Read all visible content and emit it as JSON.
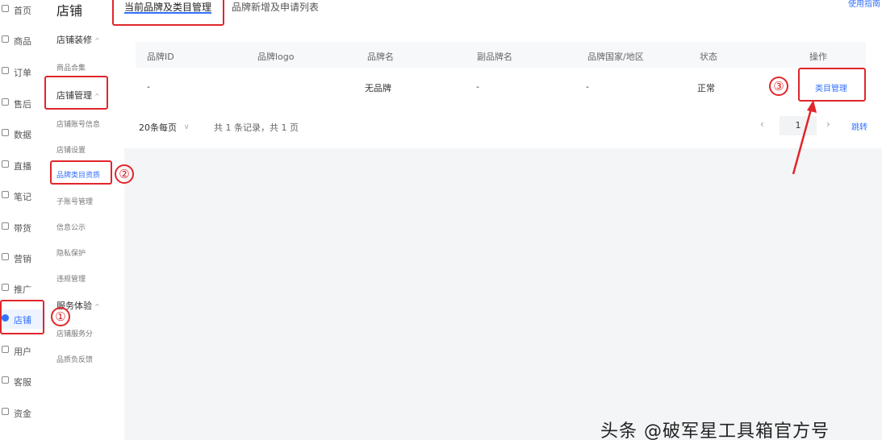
{
  "nav": {
    "items": [
      {
        "label": "首页",
        "icon": "home-icon"
      },
      {
        "label": "商品",
        "icon": "goods-icon"
      },
      {
        "label": "订单",
        "icon": "order-icon"
      },
      {
        "label": "售后",
        "icon": "after-sale-icon"
      },
      {
        "label": "数据",
        "icon": "data-icon"
      },
      {
        "label": "直播",
        "icon": "live-icon"
      },
      {
        "label": "笔记",
        "icon": "note-icon"
      },
      {
        "label": "带货",
        "icon": "promote-goods-icon"
      },
      {
        "label": "营销",
        "icon": "marketing-icon"
      },
      {
        "label": "推广",
        "icon": "ads-icon"
      },
      {
        "label": "店铺",
        "icon": "shop-icon"
      },
      {
        "label": "用户",
        "icon": "user-icon"
      },
      {
        "label": "客服",
        "icon": "service-icon"
      },
      {
        "label": "资金",
        "icon": "funds-icon"
      }
    ],
    "active_index": 10
  },
  "subnav": {
    "title": "店铺",
    "groups": [
      {
        "label": "店铺装修",
        "items": [
          "商品合集"
        ]
      },
      {
        "label": "店铺管理",
        "items": [
          "店铺账号信息",
          "店铺设置",
          "品牌类目资质",
          "子账号管理",
          "信息公示",
          "隐私保护",
          "违规管理"
        ]
      },
      {
        "label": "服务体验",
        "items": [
          "店铺服务分",
          "品质负反馈"
        ]
      }
    ],
    "caret": "^",
    "current_item": "品牌类目资质"
  },
  "tabs": {
    "current": "当前品牌及类目管理",
    "apply": "品牌新增及申请列表",
    "guide": "使用指南"
  },
  "table": {
    "headers": [
      "品牌ID",
      "品牌logo",
      "品牌名",
      "副品牌名",
      "品牌国家/地区",
      "状态",
      "操作"
    ],
    "rows": [
      {
        "brand_id": "-",
        "brand_logo": "",
        "brand_name": "无品牌",
        "sub_brand": "-",
        "country": "-",
        "status": "正常",
        "action": "类目管理"
      }
    ]
  },
  "pagination": {
    "page_size": "20条每页",
    "record_info": "共 1 条记录，共 1 页",
    "current_page": "1",
    "prev": "‹",
    "next": "›",
    "jump": "跳转"
  },
  "annotations": {
    "marks": [
      "①",
      "②",
      "③"
    ],
    "color": "#e0262b"
  },
  "accent_color": "#3370ff",
  "watermark": "头条 @破军星工具箱官方号"
}
